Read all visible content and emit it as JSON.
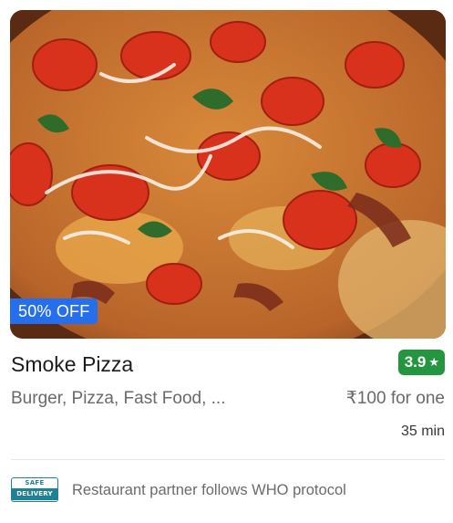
{
  "card": {
    "image_subject": "pizza with tomatoes, spinach and drizzle",
    "offer_badge": "50% OFF",
    "name": "Smoke Pizza",
    "rating": "3.9",
    "rating_icon": "star-icon",
    "cuisines": "Burger, Pizza, Fast Food, ...",
    "price": "₹100 for one",
    "delivery_time": "35 min",
    "safety_badge": {
      "icon": "safe-delivery-badge",
      "line1": "SAFE",
      "line2": "DELIVERY"
    },
    "safety_note": "Restaurant partner follows WHO protocol"
  },
  "colors": {
    "offer_badge_bg": "#256fef",
    "rating_bg": "#24963f",
    "safety_badge": "#1d8296",
    "title_text": "#1c1c1c",
    "secondary_text": "#696969"
  }
}
